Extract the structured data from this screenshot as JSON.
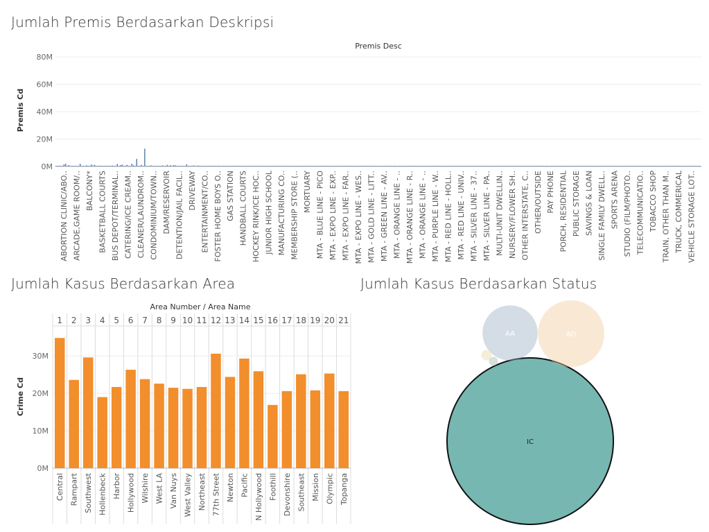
{
  "dashboard": {
    "premis_title": "Jumlah Premis Berdasarkan Deskripsi",
    "area_title": "Jumlah Kasus Berdasarkan Area",
    "status_title": "Jumlah Kasus Berdasarkan Status"
  },
  "chart_data": [
    {
      "type": "bar",
      "title": "Premis Desc",
      "xlabel": "Premis Desc",
      "ylabel": "Premis Cd",
      "ylim": [
        0,
        82000000
      ],
      "yticks": [
        "0M",
        "20M",
        "40M",
        "60M",
        "80M"
      ],
      "ytick_values": [
        0,
        20000000,
        40000000,
        60000000,
        80000000
      ],
      "bar_color": "#4e79a7",
      "grid": true,
      "categories": [
        "ABORTION CLINIC/ABO..",
        "ARCADE,GAME ROOM/..",
        "BALCONY*",
        "BASKETBALL COURTS",
        "BUS DEPOT/TERMINAL..",
        "CATERING/ICE CREAM..",
        "CLEANER/LAUNDROM..",
        "CONDOMINIUM/TOWN..",
        "DAM/RESERVOIR",
        "DETENTION/JAIL FACIL..",
        "DRIVEWAY",
        "ENTERTAINMENT/CO..",
        "FOSTER HOME BOYS O..",
        "GAS STATION",
        "HANDBALL COURTS",
        "HOCKEY RINK/ICE HOC..",
        "JUNIOR HIGH SCHOOL",
        "MANUFACTURING CO..",
        "MEMBERSHIP STORE (..",
        "MORTUARY",
        "MTA - BLUE LINE - PICO",
        "MTA - EXPO LINE - EXP..",
        "MTA - EXPO LINE - FAR..",
        "MTA - EXPO LINE - WES..",
        "MTA - GOLD LINE - LITT..",
        "MTA - GREEN LINE - AV..",
        "MTA - ORANGE LINE - ..",
        "MTA - ORANGE LINE - R..",
        "MTA - ORANGE LINE - ..",
        "MTA - PURPLE LINE - W..",
        "MTA - RED LINE - HOLL..",
        "MTA - RED LINE - UNIV..",
        "MTA - SILVER LINE - 37..",
        "MTA - SILVER LINE - PA..",
        "MULTI-UNIT DWELLIN..",
        "NURSERY/FLOWER SH..",
        "OTHER INTERSTATE, C..",
        "OTHER/OUTSIDE",
        "PAY PHONE",
        "PORCH, RESIDENTIAL",
        "PUBLIC STORAGE",
        "SAVINGS & LOAN",
        "SINGLE FAMILY DWELL..",
        "SPORTS ARENA",
        "STUDIO (FILM/PHOTO..",
        "TELECOMMUNICATIO..",
        "TOBACCO SHOP",
        "TRAIN, OTHER THAN M..",
        "TRUCK, COMMERICAL",
        "VEHICLE STORAGE LOT.."
      ],
      "series": [
        {
          "values": [
            300000,
            150000,
            600000,
            200000,
            500000,
            1500000,
            2000000,
            300000,
            1000000,
            500000,
            200000,
            500000,
            250000,
            150000,
            150000,
            2000000,
            200000,
            100000,
            300000,
            800000,
            200000,
            100000,
            1400000,
            700000,
            1200000,
            500000,
            100000,
            600000,
            250000,
            150000,
            100000,
            300000,
            200000,
            500000,
            200000,
            700000,
            100000,
            100000,
            1800000,
            200000,
            1000000,
            1300000,
            600000,
            200000,
            1200000,
            150000,
            100000,
            2000000,
            900000,
            100000,
            5500000,
            150000,
            100000,
            1200000,
            200000,
            13000000,
            150000,
            500000,
            200000,
            800000,
            100000,
            200000,
            100000,
            100000,
            200000,
            500000,
            800000,
            300000,
            100000,
            1200000,
            500000,
            900000,
            400000,
            1000000,
            800000,
            200000,
            500000,
            200000,
            200000,
            150000,
            300000,
            1600000,
            200000,
            100000,
            300000,
            800000,
            200000,
            100000,
            700000,
            200000,
            100000,
            100000,
            100000,
            100000,
            100000,
            100000,
            100000,
            100000,
            100000,
            100000,
            100000,
            100000,
            100000,
            100000,
            100000,
            100000,
            100000,
            100000,
            100000,
            100000,
            100000,
            100000,
            100000,
            100000,
            100000,
            100000,
            100000,
            100000,
            100000,
            100000,
            100000,
            100000,
            100000,
            100000,
            100000,
            100000,
            100000,
            100000,
            100000,
            100000,
            100000,
            100000,
            100000,
            100000,
            100000,
            100000,
            100000,
            100000,
            100000,
            100000,
            100000,
            100000,
            100000,
            100000,
            100000,
            100000,
            100000,
            100000,
            100000,
            100000,
            100000,
            100000,
            100000,
            100000,
            100000,
            100000,
            100000,
            100000,
            100000,
            100000,
            100000,
            100000,
            100000,
            100000,
            100000,
            100000,
            100000,
            100000,
            100000,
            100000,
            100000,
            100000,
            100000,
            100000,
            100000,
            100000,
            100000,
            100000,
            100000,
            100000,
            100000,
            100000,
            100000,
            100000,
            100000,
            100000,
            100000,
            100000,
            100000,
            100000,
            100000,
            100000,
            100000,
            100000,
            100000,
            100000,
            100000,
            100000,
            100000,
            100000,
            100000,
            100000,
            100000,
            100000,
            100000,
            100000,
            100000,
            100000,
            100000,
            100000,
            100000,
            100000,
            100000,
            100000,
            100000,
            100000,
            100000,
            100000,
            100000,
            100000,
            100000,
            100000,
            100000,
            100000,
            100000,
            100000,
            100000,
            100000,
            100000,
            100000,
            100000,
            100000,
            100000,
            100000,
            100000,
            100000,
            100000,
            100000,
            100000,
            100000,
            100000,
            100000,
            100000,
            100000,
            100000,
            100000,
            100000,
            100000,
            100000,
            100000,
            100000,
            100000,
            100000,
            100000,
            100000,
            100000,
            100000,
            100000,
            100000,
            100000,
            100000,
            100000,
            100000,
            100000,
            100000,
            100000,
            100000,
            100000,
            100000,
            100000,
            100000,
            100000,
            100000,
            100000,
            100000,
            100000,
            100000,
            100000,
            100000,
            100000,
            100000,
            100000,
            100000,
            100000,
            100000,
            100000,
            100000,
            100000,
            100000,
            100000,
            100000,
            100000,
            100000,
            100000,
            100000,
            100000,
            100000,
            100000,
            100000,
            100000,
            100000,
            100000,
            100000,
            100000,
            100000,
            100000,
            100000,
            100000,
            100000,
            100000,
            100000,
            100000,
            100000,
            100000,
            100000,
            100000,
            100000,
            100000,
            100000,
            100000,
            100000,
            100000,
            100000,
            100000,
            100000,
            100000,
            100000,
            100000,
            100000,
            100000,
            100000,
            100000,
            100000,
            100000,
            100000,
            100000,
            100000,
            100000,
            100000,
            100000,
            100000,
            100000,
            100000,
            100000,
            100000,
            100000,
            100000,
            100000,
            100000,
            100000,
            100000,
            100000,
            100000,
            100000,
            100000,
            100000,
            100000,
            100000,
            100000,
            100000,
            100000,
            100000,
            100000,
            100000,
            100000,
            100000,
            100000,
            100000,
            100000,
            100000,
            100000,
            100000,
            100000,
            100000,
            100000,
            100000,
            100000,
            100000,
            100000,
            100000,
            100000,
            100000,
            100000,
            100000,
            100000,
            100000,
            100000,
            100000,
            100000,
            100000,
            100000,
            100000,
            100000,
            100000,
            100000,
            100000,
            100000,
            100000,
            100000,
            100000
          ]
        }
      ]
    },
    {
      "type": "bar",
      "title": "Area Number / Area Name",
      "ylabel": "Crime Cd",
      "ylim": [
        0,
        38000000
      ],
      "yticks": [
        "0M",
        "10M",
        "20M",
        "30M"
      ],
      "ytick_values": [
        0,
        10000000,
        20000000,
        30000000
      ],
      "bar_color": "#f28e2b",
      "grid": true,
      "area_numbers": [
        "1",
        "2",
        "3",
        "4",
        "5",
        "6",
        "7",
        "8",
        "9",
        "10",
        "11",
        "12",
        "13",
        "14",
        "15",
        "16",
        "17",
        "18",
        "19",
        "20",
        "21"
      ],
      "categories": [
        "Central",
        "Rampart",
        "Southwest",
        "Hollenbeck",
        "Harbor",
        "Hollywood",
        "Wilshire",
        "West LA",
        "Van Nuys",
        "West Valley",
        "Northeast",
        "77th Street",
        "Newton",
        "Pacific",
        "N Hollywood",
        "Foothill",
        "Devonshire",
        "Southeast",
        "Mission",
        "Olympic",
        "Topanga"
      ],
      "values": [
        34800000,
        23600000,
        29600000,
        19000000,
        21700000,
        26300000,
        23800000,
        22600000,
        21500000,
        21200000,
        21700000,
        30600000,
        24400000,
        29300000,
        25900000,
        16900000,
        20600000,
        25100000,
        20800000,
        25300000,
        20600000
      ]
    },
    {
      "type": "bubble",
      "title": "Jumlah Kasus Berdasarkan Status",
      "legend_position": "none",
      "bubbles": [
        {
          "label": "IC",
          "value": 1000,
          "color": "#76b7b2",
          "selected": true
        },
        {
          "label": "AO",
          "value": 160,
          "color": "#f1ce9f"
        },
        {
          "label": "AA",
          "value": 110,
          "color": "#a0b4c8"
        },
        {
          "label": "",
          "value": 4,
          "color": "#e8d9a8"
        },
        {
          "label": "",
          "value": 3,
          "color": "#a9bfae"
        }
      ]
    }
  ]
}
